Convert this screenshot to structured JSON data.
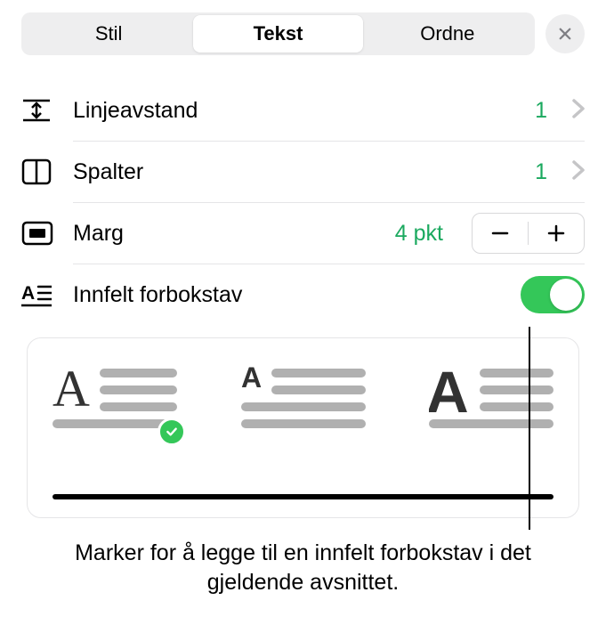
{
  "tabs": {
    "stil": "Stil",
    "tekst": "Tekst",
    "ordne": "Ordne"
  },
  "rows": {
    "lineSpacing": {
      "label": "Linjeavstand",
      "value": "1"
    },
    "columns": {
      "label": "Spalter",
      "value": "1"
    },
    "margin": {
      "label": "Marg",
      "value": "4 pkt"
    },
    "dropCap": {
      "label": "Innfelt forbokstav"
    }
  },
  "caption": "Marker for å legge til en innfelt forbokstav i det gjeldende avsnittet."
}
